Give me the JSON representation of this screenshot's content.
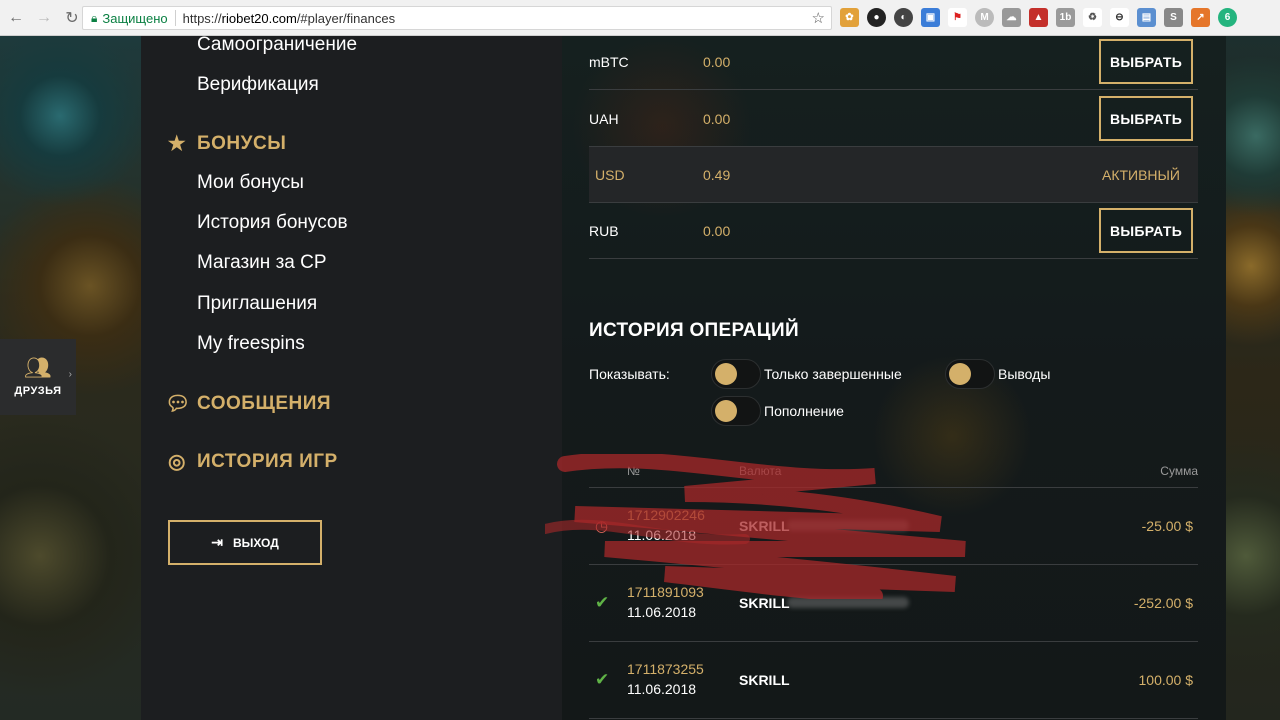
{
  "browser": {
    "secure_label": "Защищено",
    "url_scheme": "https://",
    "url_host": "riobet20.com",
    "url_path": "/#player/finances"
  },
  "friends_tab": {
    "label": "ДРУЗЬЯ"
  },
  "sidebar": {
    "top_items": [
      "Самоограничение",
      "Верификация"
    ],
    "bonuses": {
      "title": "БОНУСЫ",
      "items": [
        "Мои бонусы",
        "История бонусов",
        "Магазин за CP",
        "Приглашения",
        "My freespins"
      ]
    },
    "messages_title": "СООБЩЕНИЯ",
    "games_history_title": "ИСТОРИЯ ИГР",
    "logout_label": "ВЫХОД"
  },
  "currencies": [
    {
      "code": "mBTC",
      "amount": "0.00",
      "action": "ВЫБРАТЬ"
    },
    {
      "code": "UAH",
      "amount": "0.00",
      "action": "ВЫБРАТЬ"
    },
    {
      "code": "USD",
      "amount": "0.49",
      "status": "АКТИВНЫЙ"
    },
    {
      "code": "RUB",
      "amount": "0.00",
      "action": "ВЫБРАТЬ"
    }
  ],
  "history": {
    "title": "ИСТОРИЯ ОПЕРАЦИЙ",
    "show_label": "Показывать:",
    "filters": [
      "Только завершенные",
      "Выводы",
      "Пополнение"
    ],
    "columns": {
      "number": "№",
      "currency": "Валюта",
      "amount": "Сумма"
    },
    "rows": [
      {
        "id": "1712902246",
        "date": "11.06.2018",
        "method": "SKRILL",
        "amount": "-25.00 $",
        "status": "pending"
      },
      {
        "id": "1711891093",
        "date": "11.06.2018",
        "method": "SKRILL",
        "amount": "-252.00 $",
        "status": "completed"
      },
      {
        "id": "1711873255",
        "date": "11.06.2018",
        "method": "SKRILL",
        "amount": "100.00 $",
        "status": "completed"
      }
    ]
  },
  "colors": {
    "accent": "#d4b06a",
    "pending": "#e0675a",
    "success": "#5fb246",
    "sidebar_bg": "#1c1e20"
  }
}
